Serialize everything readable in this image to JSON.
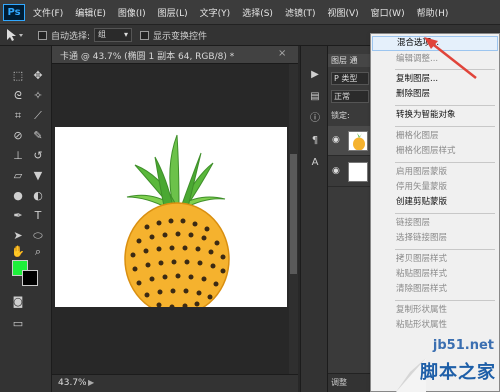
{
  "app": {
    "logo": "Ps",
    "menu": [
      "文件(F)",
      "编辑(E)",
      "图像(I)",
      "图层(L)",
      "文字(Y)",
      "选择(S)",
      "滤镜(T)",
      "视图(V)",
      "窗口(W)",
      "帮助(H)"
    ]
  },
  "options_bar": {
    "tool_icon": "move-tool-icon",
    "auto_select_label": "自动选择:",
    "auto_select_value": "组",
    "show_transform_label": "显示变换控件"
  },
  "document": {
    "tab_title": "卡通 @ 43.7% (椭圆 1 副本 64, RGB/8) *",
    "close_glyph": "×",
    "zoom": "43.7%"
  },
  "tool_colors": {
    "foreground": "#1ef03b",
    "background": "#000000"
  },
  "layers_panel": {
    "tab": "图层 通",
    "filter": "P 类型",
    "blend_mode": "正常",
    "lock_label": "锁定:",
    "bottom": "调整"
  },
  "context_menu": {
    "items": [
      {
        "label": "混合选项...",
        "enabled": true,
        "highlighted": true
      },
      {
        "label": "编辑调整...",
        "enabled": false
      },
      {
        "separator": true
      },
      {
        "label": "复制图层...",
        "enabled": true
      },
      {
        "label": "删除图层",
        "enabled": true
      },
      {
        "separator": true
      },
      {
        "label": "转换为智能对象",
        "enabled": true
      },
      {
        "separator": true
      },
      {
        "label": "栅格化图层",
        "enabled": false
      },
      {
        "label": "栅格化图层样式",
        "enabled": false
      },
      {
        "separator": true
      },
      {
        "label": "启用图层蒙版",
        "enabled": false
      },
      {
        "label": "停用矢量蒙版",
        "enabled": false
      },
      {
        "label": "创建剪贴蒙版",
        "enabled": true
      },
      {
        "separator": true
      },
      {
        "label": "链接图层",
        "enabled": false
      },
      {
        "label": "选择链接图层",
        "enabled": false
      },
      {
        "separator": true
      },
      {
        "label": "拷贝图层样式",
        "enabled": false
      },
      {
        "label": "粘贴图层样式",
        "enabled": false
      },
      {
        "label": "清除图层样式",
        "enabled": false
      },
      {
        "separator": true
      },
      {
        "label": "复制形状属性",
        "enabled": false
      },
      {
        "label": "粘贴形状属性",
        "enabled": false
      }
    ]
  },
  "watermark": {
    "site": "jb51.net",
    "name": "脚本之家"
  },
  "colors": {
    "accent_highlight": "#e5f0fb",
    "arrow": "#e0443a"
  }
}
